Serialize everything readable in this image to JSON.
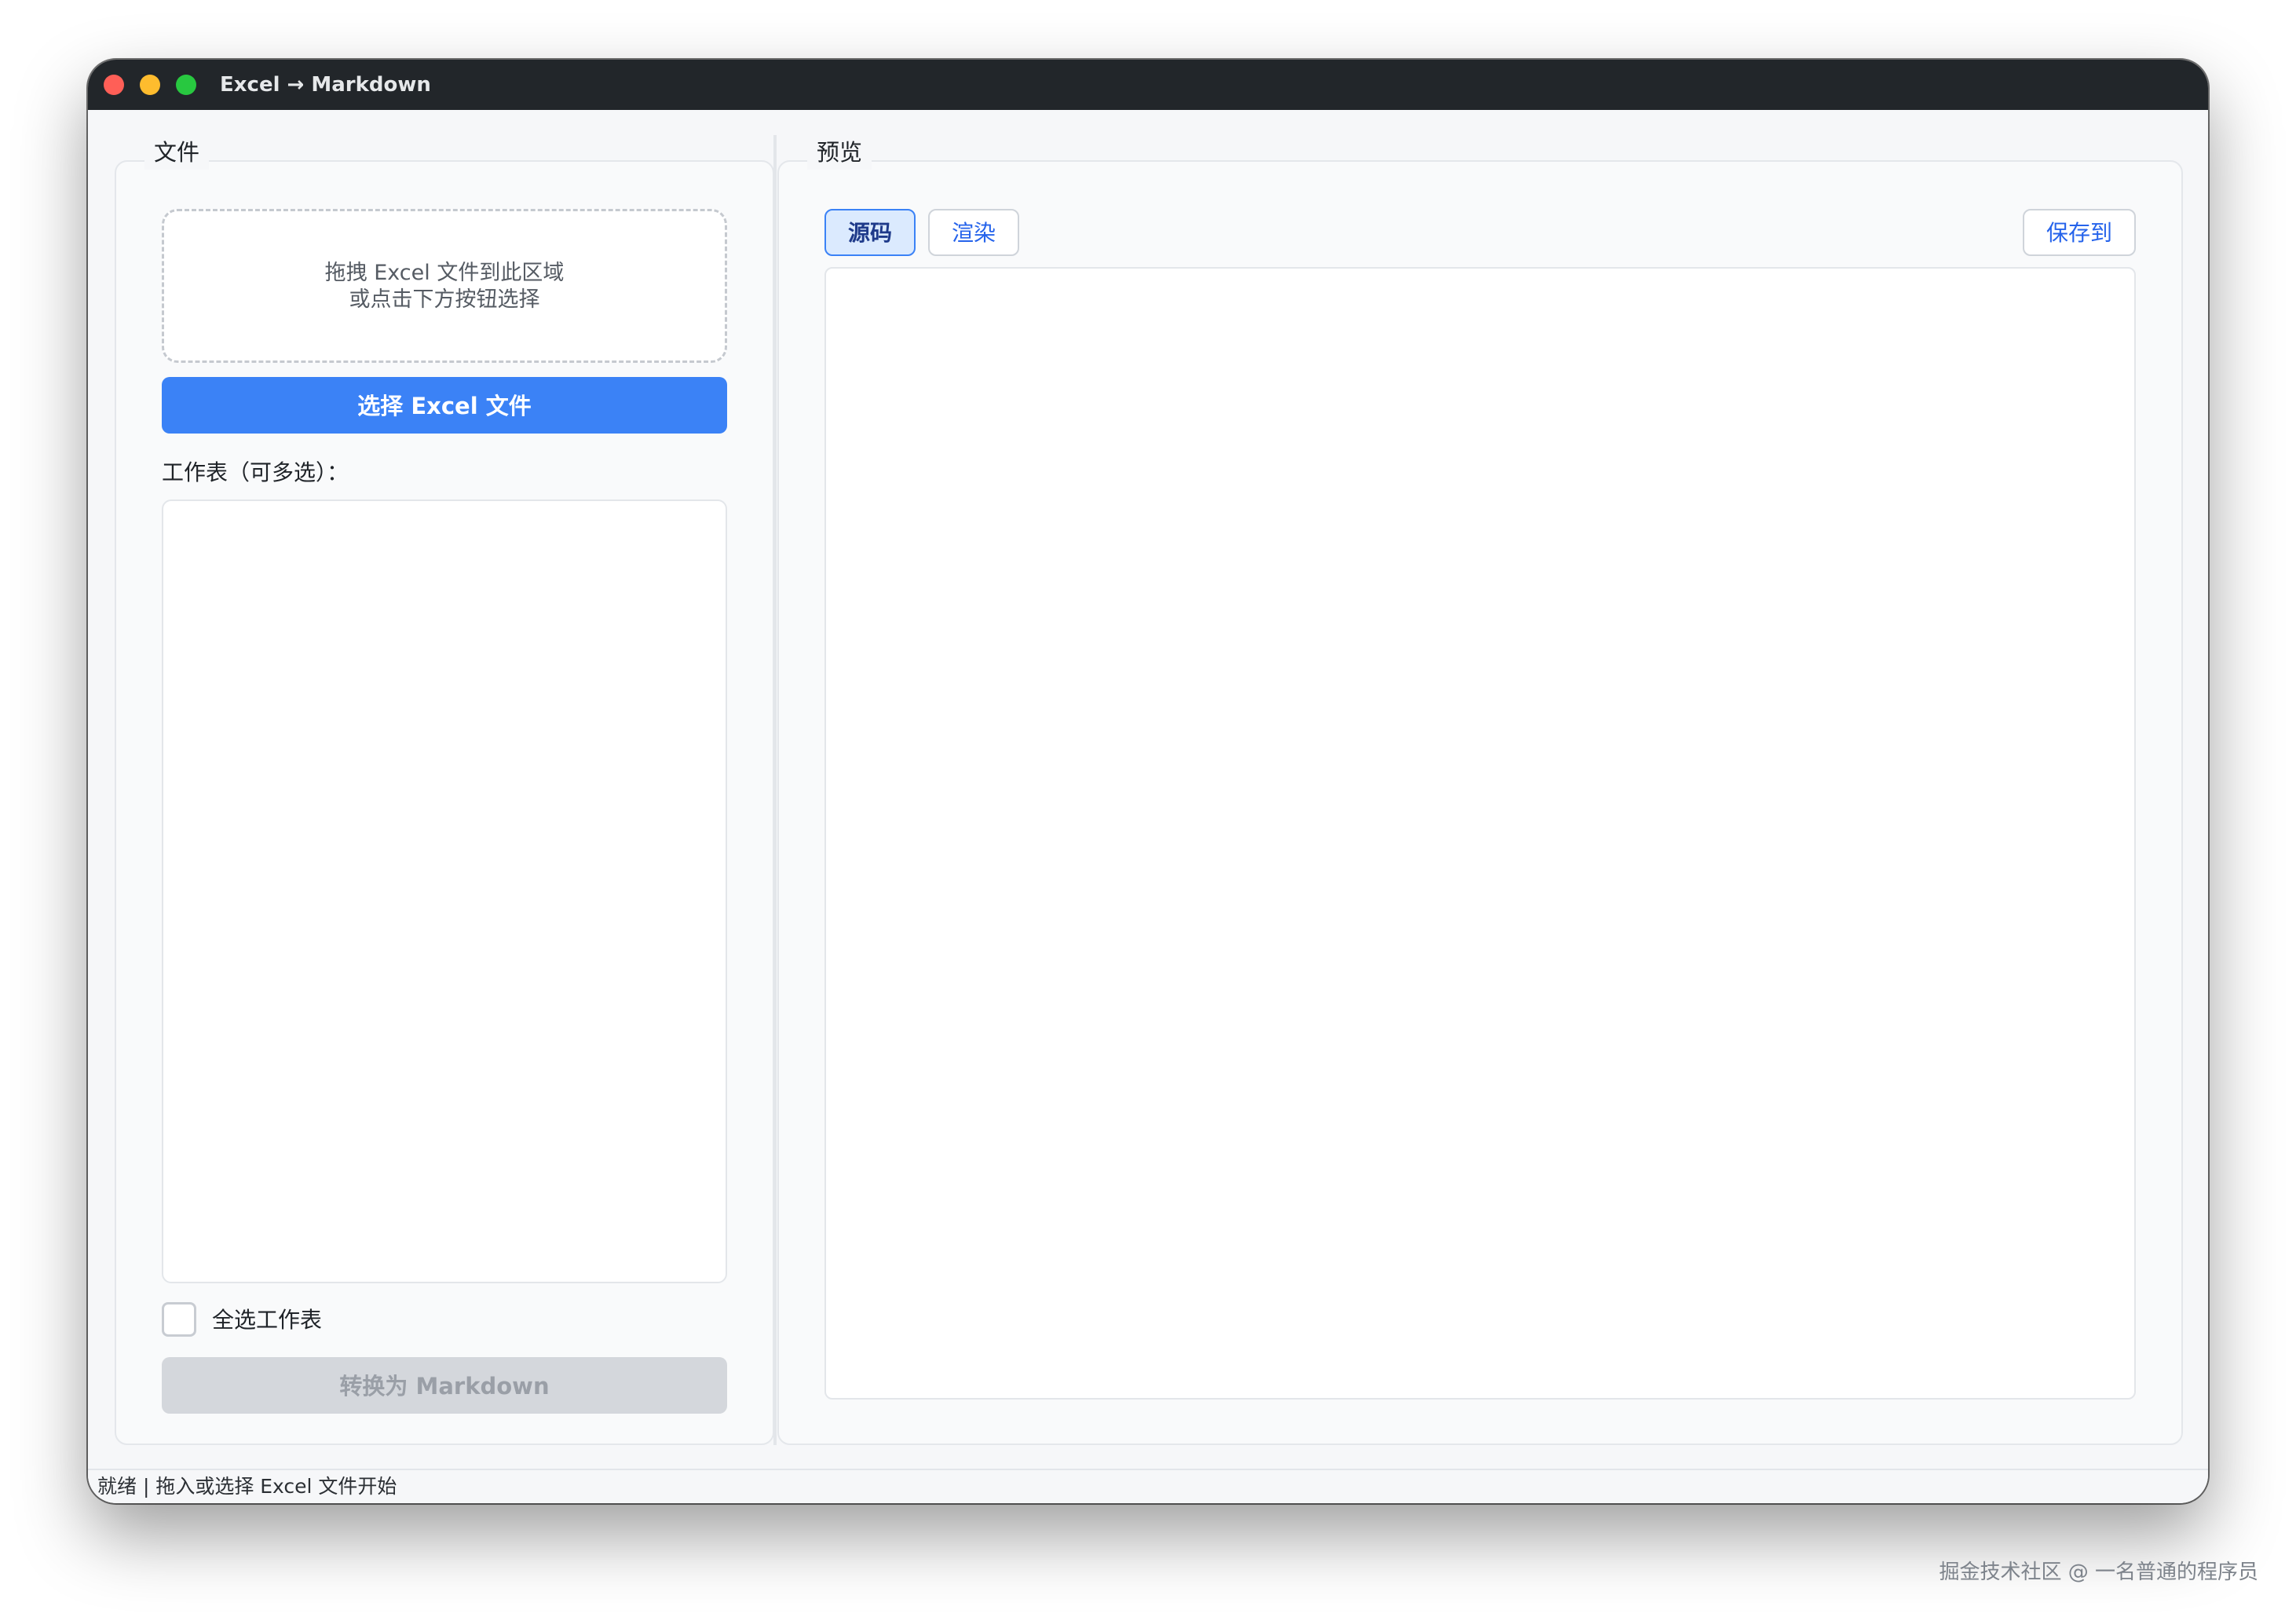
{
  "window": {
    "title": "Excel → Markdown"
  },
  "file_panel": {
    "legend": "文件",
    "dropzone": {
      "line1": "拖拽 Excel 文件到此区域",
      "line2": "或点击下方按钮选择"
    },
    "select_button": "选择 Excel 文件",
    "sheets_label": "工作表（可多选）：",
    "select_all_label": "全选工作表",
    "select_all_checked": false,
    "convert_button": "转换为 Markdown",
    "convert_enabled": false
  },
  "preview_panel": {
    "legend": "预览",
    "tabs": [
      {
        "label": "源码",
        "active": true
      },
      {
        "label": "渲染",
        "active": false
      }
    ],
    "save_button": "保存到"
  },
  "status": {
    "text": "就绪 | 拖入或选择 Excel 文件开始"
  },
  "watermark": {
    "text": "掘金技术社区 @ 一名普通的程序员"
  },
  "colors": {
    "accent": "#3b82f6",
    "titlebar": "#22262a",
    "close": "#ff5f57",
    "minimize": "#febc2e",
    "maximize": "#28c840",
    "disabled": "#d4d7dc"
  }
}
